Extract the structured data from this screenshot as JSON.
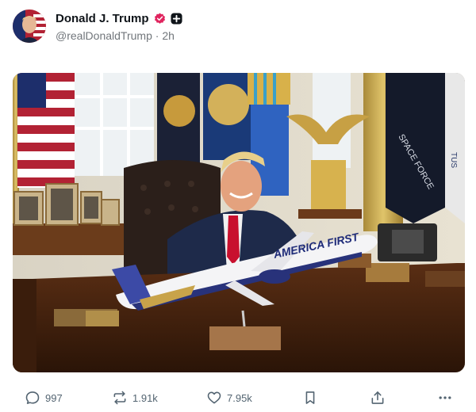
{
  "post": {
    "author": {
      "display_name": "Donald J. Trump",
      "handle": "@realDonaldTrump",
      "separator": "·",
      "time": "2h"
    },
    "media": {
      "plane_text": "AMERICA FIRST",
      "flag_text": "SPACE FORCE",
      "flag_text_partial": "TUS"
    },
    "actions": {
      "replies": "997",
      "reposts": "1.91k",
      "likes": "7.95k"
    }
  },
  "colors": {
    "verified_badge": "#e0245e",
    "icon_gray": "#536471",
    "handle_gray": "#71767b"
  },
  "icons": [
    "verified-icon",
    "plus-badge-icon",
    "reply-icon",
    "repost-icon",
    "like-icon",
    "bookmark-icon",
    "share-icon",
    "more-icon"
  ]
}
